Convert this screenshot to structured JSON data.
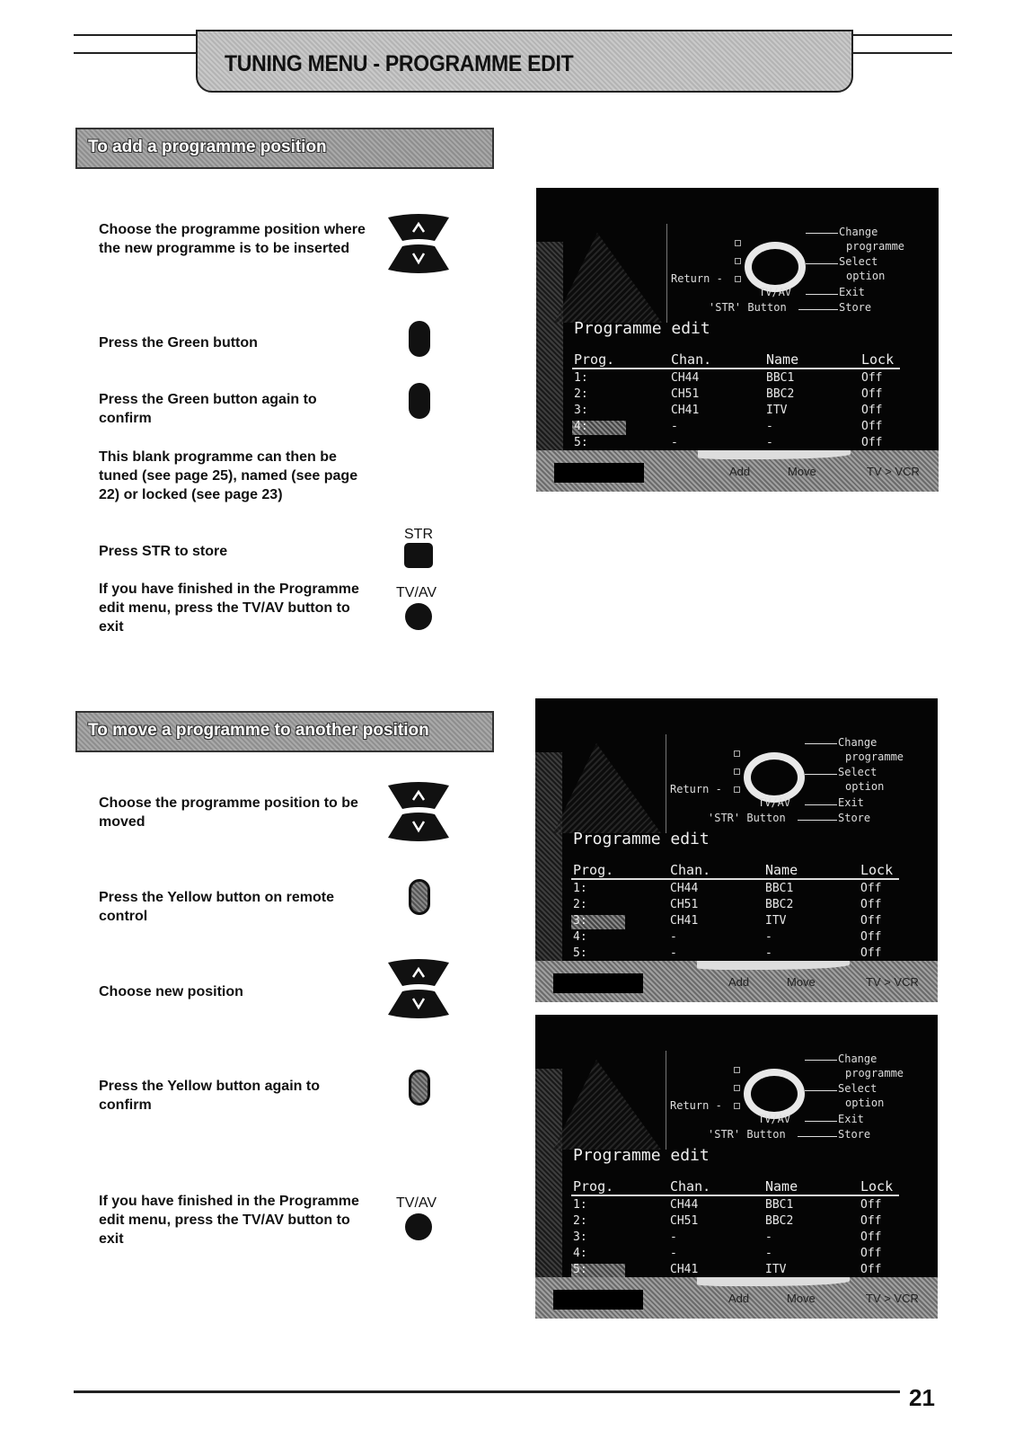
{
  "header": {
    "title": "TUNING MENU - PROGRAMME EDIT"
  },
  "sections": [
    {
      "title": "To add a programme position",
      "steps": [
        {
          "text": "Choose the programme position where the new programme is to be inserted",
          "icon": "up-down-buttons"
        },
        {
          "text": "Press the Green button",
          "icon": "green-button"
        },
        {
          "text": "Press the Green button again to confirm",
          "icon": "green-button"
        },
        {
          "text": "This blank programme can then be tuned (see page 25), named (see page 22) or locked (see page 23)",
          "icon": ""
        },
        {
          "text": "Press STR to store",
          "icon": "str-button",
          "icon_label": "STR"
        },
        {
          "text": "If you have finished in the Programme edit menu, press the TV/AV button to exit",
          "icon": "tvav-button",
          "icon_label": "TV/AV"
        }
      ]
    },
    {
      "title": "To move a programme to another position",
      "steps": [
        {
          "text": "Choose the programme position to be moved",
          "icon": "up-down-buttons"
        },
        {
          "text": "Press the Yellow button on remote control",
          "icon": "yellow-button"
        },
        {
          "text": "Choose new position",
          "icon": "up-down-buttons"
        },
        {
          "text": "Press the Yellow button again to confirm",
          "icon": "yellow-button"
        },
        {
          "text": "If you have finished in the Programme edit menu, press the TV/AV button to exit",
          "icon": "tvav-button",
          "icon_label": "TV/AV"
        }
      ]
    }
  ],
  "osd_common": {
    "help": {
      "change": "Change",
      "programme": "programme",
      "select": "Select",
      "option": "option",
      "return": "Return -",
      "tvav": "TV/AV",
      "exit": "Exit",
      "str_button": "'STR' Button",
      "store": "Store"
    },
    "title": "Programme edit",
    "columns": [
      "Prog.",
      "Chan.",
      "Name",
      "Lock"
    ],
    "footer": [
      "Add",
      "Move",
      "TV > VCR"
    ]
  },
  "screens": [
    {
      "highlight_row": 4,
      "rows": [
        [
          "1:",
          "CH44",
          "BBC1",
          "Off"
        ],
        [
          "2:",
          "CH51",
          "BBC2",
          "Off"
        ],
        [
          "3:",
          "CH41",
          "ITV",
          "Off"
        ],
        [
          "4:",
          "-",
          "-",
          "Off"
        ],
        [
          "5:",
          "-",
          "-",
          "Off"
        ]
      ]
    },
    {
      "highlight_row": 3,
      "rows": [
        [
          "1:",
          "CH44",
          "BBC1",
          "Off"
        ],
        [
          "2:",
          "CH51",
          "BBC2",
          "Off"
        ],
        [
          "3:",
          "CH41",
          "ITV",
          "Off"
        ],
        [
          "4:",
          "-",
          "-",
          "Off"
        ],
        [
          "5:",
          "-",
          "-",
          "Off"
        ]
      ]
    },
    {
      "highlight_row": 5,
      "rows": [
        [
          "1:",
          "CH44",
          "BBC1",
          "Off"
        ],
        [
          "2:",
          "CH51",
          "BBC2",
          "Off"
        ],
        [
          "3:",
          "-",
          "-",
          "Off"
        ],
        [
          "4:",
          "-",
          "-",
          "Off"
        ],
        [
          "5:",
          "CH41",
          "ITV",
          "Off"
        ]
      ]
    }
  ],
  "page_number": "21"
}
